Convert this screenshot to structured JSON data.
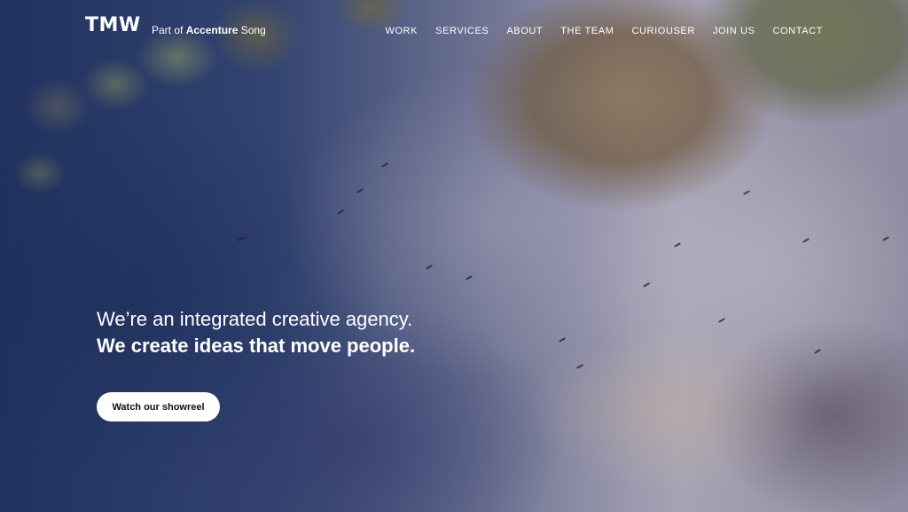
{
  "brand": {
    "logo": "TMW",
    "sub_prefix": "Part of",
    "sub_bold": "Accenture",
    "sub_suffix": "Song"
  },
  "nav": {
    "items": [
      "WORK",
      "SERVICES",
      "ABOUT",
      "THE TEAM",
      "CURIOUSER",
      "JOIN US",
      "CONTACT"
    ]
  },
  "hero": {
    "line1": "We’re an integrated creative agency.",
    "line2": "We create ideas that move people.",
    "cta_label": "Watch our showreel"
  }
}
